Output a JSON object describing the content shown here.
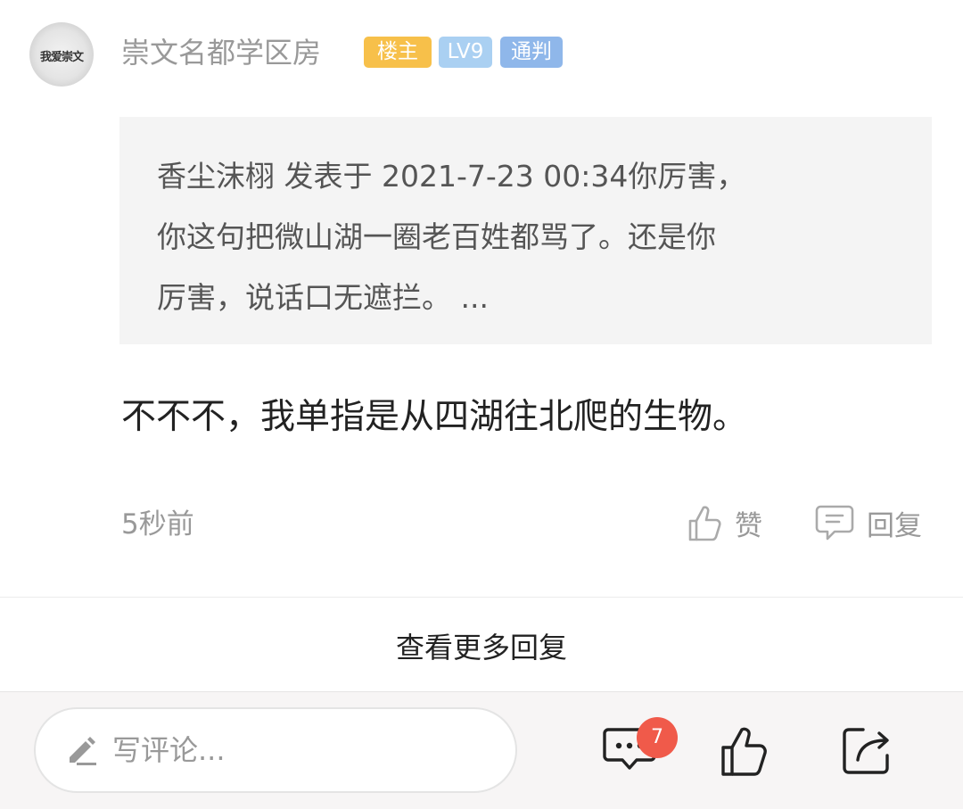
{
  "post": {
    "avatar_text": "我爱崇文",
    "username": "崇文名都学区房",
    "badges": {
      "louzhu": "楼主",
      "level": "LV9",
      "tongpan": "通判"
    },
    "quote": {
      "line1": "香尘沫栩 发表于 2021-7-23 00:34你厉害，",
      "line2": "你这句把微山湖一圈老百姓都骂了。还是你",
      "line3": "厉害，说话口无遮拦。 ..."
    },
    "content": "不不不，我单指是从四湖往北爬的生物。",
    "time": "5秒前",
    "like_label": "赞",
    "reply_label": "回复"
  },
  "more_replies_label": "查看更多回复",
  "bottom_bar": {
    "comment_placeholder": "写评论...",
    "comment_count": "7"
  },
  "colors": {
    "louzhu_badge": "#f7c04a",
    "level_badge": "#aad0f2",
    "tongpan_badge": "#8fb7ea",
    "count_badge": "#f05a4a"
  },
  "icons": {
    "like": "thumb-up-outline-icon",
    "reply": "comment-bubble-icon",
    "edit": "pencil-icon",
    "comments": "chat-dots-icon",
    "thumb": "thumb-up-icon",
    "share": "share-icon"
  }
}
